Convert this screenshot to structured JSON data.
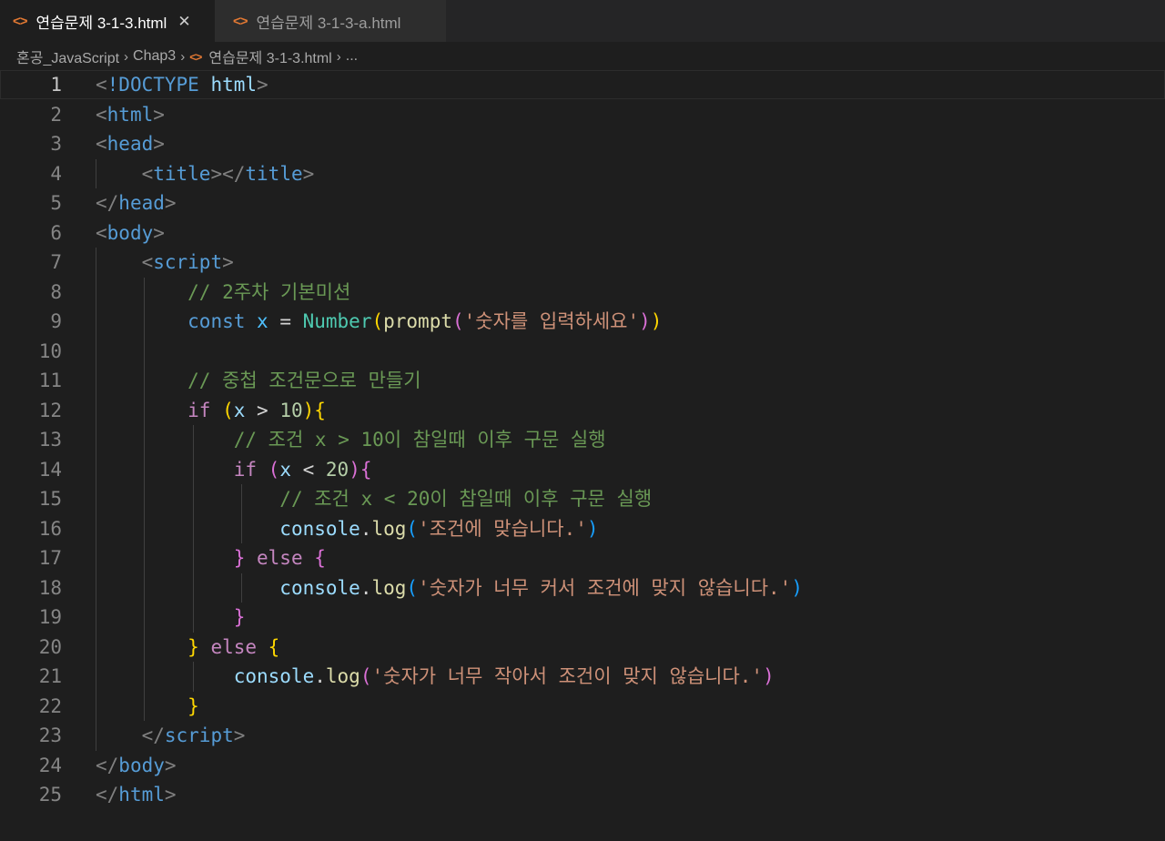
{
  "tabs": [
    {
      "label": "연습문제 3-1-3.html",
      "icon": "html-file-icon",
      "active": true
    },
    {
      "label": "연습문제 3-1-3-a.html",
      "icon": "html-file-icon",
      "active": false
    }
  ],
  "close_glyph": "✕",
  "breadcrumb": [
    "혼공_JavaScript",
    "Chap3",
    "연습문제 3-1-3.html",
    "..."
  ],
  "colors": {
    "background": "#1e1e1e",
    "html_icon": "#e37933",
    "comment": "#6a9955",
    "keyword": "#569cd6",
    "control": "#c586c0",
    "string": "#ce9178",
    "function": "#dcdcaa"
  },
  "current_line": 1,
  "lines": [
    [
      [
        "t-punc",
        "<"
      ],
      [
        "t-tag",
        "!DOCTYPE "
      ],
      [
        "t-attr",
        "html"
      ],
      [
        "t-punc",
        ">"
      ]
    ],
    [
      [
        "t-punc",
        "<"
      ],
      [
        "t-tag",
        "html"
      ],
      [
        "t-punc",
        ">"
      ]
    ],
    [
      [
        "t-punc",
        "<"
      ],
      [
        "t-tag",
        "head"
      ],
      [
        "t-punc",
        ">"
      ]
    ],
    [
      [
        "t-txt",
        "    "
      ],
      [
        "t-punc",
        "<"
      ],
      [
        "t-tag",
        "title"
      ],
      [
        "t-punc",
        "></"
      ],
      [
        "t-tag",
        "title"
      ],
      [
        "t-punc",
        ">"
      ]
    ],
    [
      [
        "t-punc",
        "</"
      ],
      [
        "t-tag",
        "head"
      ],
      [
        "t-punc",
        ">"
      ]
    ],
    [
      [
        "t-punc",
        "<"
      ],
      [
        "t-tag",
        "body"
      ],
      [
        "t-punc",
        ">"
      ]
    ],
    [
      [
        "t-txt",
        "    "
      ],
      [
        "t-punc",
        "<"
      ],
      [
        "t-tag",
        "script"
      ],
      [
        "t-punc",
        ">"
      ]
    ],
    [
      [
        "t-txt",
        "        "
      ],
      [
        "t-com",
        "// 2주차 기본미션"
      ]
    ],
    [
      [
        "t-txt",
        "        "
      ],
      [
        "t-kw",
        "const "
      ],
      [
        "t-var",
        "x"
      ],
      [
        "t-op",
        " = "
      ],
      [
        "t-cls",
        "Number"
      ],
      [
        "t-b1",
        "("
      ],
      [
        "t-fn",
        "prompt"
      ],
      [
        "t-b2",
        "("
      ],
      [
        "t-str",
        "'숫자를 입력하세요'"
      ],
      [
        "t-b2",
        ")"
      ],
      [
        "t-b1",
        ")"
      ]
    ],
    [],
    [
      [
        "t-txt",
        "        "
      ],
      [
        "t-com",
        "// 중첩 조건문으로 만들기"
      ]
    ],
    [
      [
        "t-txt",
        "        "
      ],
      [
        "t-ctl",
        "if "
      ],
      [
        "t-b1",
        "("
      ],
      [
        "t-prop",
        "x"
      ],
      [
        "t-op",
        " > "
      ],
      [
        "t-num",
        "10"
      ],
      [
        "t-b1",
        ")"
      ],
      [
        "t-b1",
        "{"
      ]
    ],
    [
      [
        "t-txt",
        "            "
      ],
      [
        "t-com",
        "// 조건 x > 10이 참일때 이후 구문 실행"
      ]
    ],
    [
      [
        "t-txt",
        "            "
      ],
      [
        "t-ctl",
        "if "
      ],
      [
        "t-b2",
        "("
      ],
      [
        "t-prop",
        "x"
      ],
      [
        "t-op",
        " < "
      ],
      [
        "t-num",
        "20"
      ],
      [
        "t-b2",
        ")"
      ],
      [
        "t-b2",
        "{"
      ]
    ],
    [
      [
        "t-txt",
        "                "
      ],
      [
        "t-com",
        "// 조건 x < 20이 참일때 이후 구문 실행"
      ]
    ],
    [
      [
        "t-txt",
        "                "
      ],
      [
        "t-prop",
        "console"
      ],
      [
        "t-op",
        "."
      ],
      [
        "t-fn",
        "log"
      ],
      [
        "t-b3",
        "("
      ],
      [
        "t-str",
        "'조건에 맞습니다.'"
      ],
      [
        "t-b3",
        ")"
      ]
    ],
    [
      [
        "t-txt",
        "            "
      ],
      [
        "t-b2",
        "}"
      ],
      [
        "t-ctl",
        " else "
      ],
      [
        "t-b2",
        "{"
      ]
    ],
    [
      [
        "t-txt",
        "                "
      ],
      [
        "t-prop",
        "console"
      ],
      [
        "t-op",
        "."
      ],
      [
        "t-fn",
        "log"
      ],
      [
        "t-b3",
        "("
      ],
      [
        "t-str",
        "'숫자가 너무 커서 조건에 맞지 않습니다.'"
      ],
      [
        "t-b3",
        ")"
      ]
    ],
    [
      [
        "t-txt",
        "            "
      ],
      [
        "t-b2",
        "}"
      ]
    ],
    [
      [
        "t-txt",
        "        "
      ],
      [
        "t-b1",
        "}"
      ],
      [
        "t-ctl",
        " else "
      ],
      [
        "t-b1",
        "{"
      ]
    ],
    [
      [
        "t-txt",
        "            "
      ],
      [
        "t-prop",
        "console"
      ],
      [
        "t-op",
        "."
      ],
      [
        "t-fn",
        "log"
      ],
      [
        "t-b2",
        "("
      ],
      [
        "t-str",
        "'숫자가 너무 작아서 조건이 맞지 않습니다.'"
      ],
      [
        "t-b2",
        ")"
      ]
    ],
    [
      [
        "t-txt",
        "        "
      ],
      [
        "t-b1",
        "}"
      ]
    ],
    [
      [
        "t-txt",
        "    "
      ],
      [
        "t-punc",
        "</"
      ],
      [
        "t-tag",
        "script"
      ],
      [
        "t-punc",
        ">"
      ]
    ],
    [
      [
        "t-punc",
        "</"
      ],
      [
        "t-tag",
        "body"
      ],
      [
        "t-punc",
        ">"
      ]
    ],
    [
      [
        "t-punc",
        "</"
      ],
      [
        "t-tag",
        "html"
      ],
      [
        "t-punc",
        ">"
      ]
    ]
  ]
}
